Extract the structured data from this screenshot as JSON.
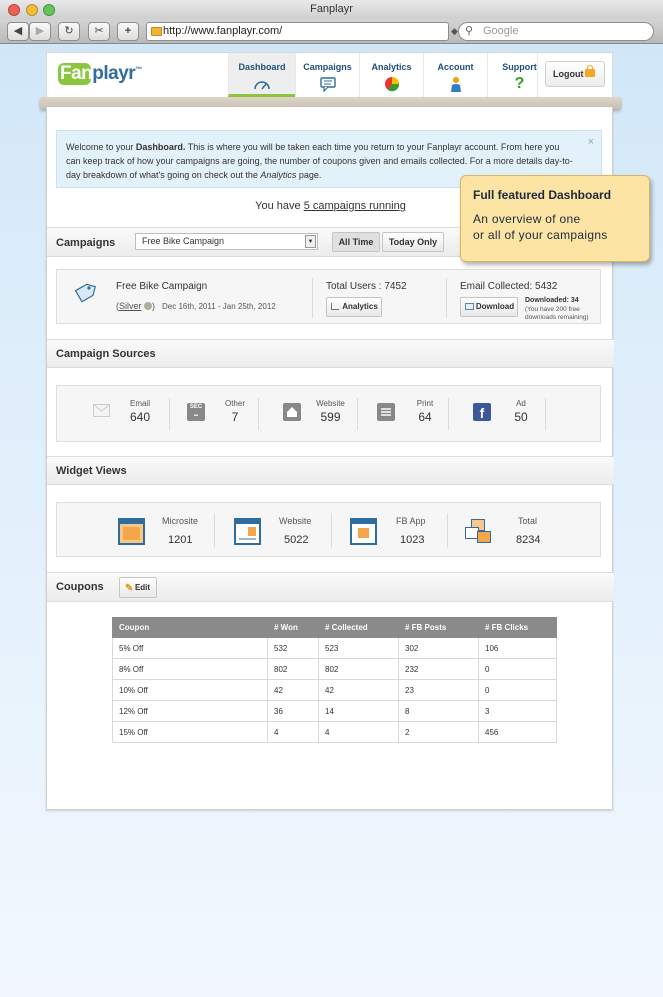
{
  "window": {
    "title": "Fanplayr"
  },
  "browser": {
    "url": "http://www.fanplayr.com/",
    "search_placeholder": "Google"
  },
  "logo": {
    "text": "Fanplayr",
    "tm": "™"
  },
  "nav": {
    "items": [
      {
        "label": "Dashboard",
        "icon": "speedometer-icon"
      },
      {
        "label": "Campaigns",
        "icon": "chat-bubble-icon"
      },
      {
        "label": "Analytics",
        "icon": "pie-chart-icon"
      },
      {
        "label": "Account",
        "icon": "user-icon"
      },
      {
        "label": "Support",
        "icon": "question-icon"
      }
    ],
    "logout_label": "Logout"
  },
  "welcome": {
    "p1": "Welcome to your ",
    "bold": "Dashboard.",
    "p2": " This is where you will be taken each time you return to your Fanplayr account. From here you can keep track of how your campaigns are going, the number of coupons given and emails collected. For a more details day-to-day breakdown of what's going on check out the ",
    "italic": "Analytics",
    "p3": " page.",
    "close": "×"
  },
  "running": {
    "prefix": "You have ",
    "link": "5 campaigns running"
  },
  "campaigns_bar": {
    "title": "Campaigns",
    "selected": "Free Bike Campaign",
    "all_time": "All Time",
    "today_only": "Today Only"
  },
  "campaign": {
    "name": "Free Bike Campaign",
    "level": "Silver",
    "dates": "Dec 16th, 2011 - Jan 25th, 2012",
    "total_users_label": "Total Users : 7452",
    "analytics_btn": "Analytics",
    "email_collected_label": "Email Collected: 5432",
    "download_btn": "Download",
    "downloaded": "Downloaded: 34",
    "remaining": "(You have 200 free downloads remaining)"
  },
  "sources": {
    "title": "Campaign Sources",
    "items": [
      {
        "label": "Email",
        "value": "640",
        "icon": "envelope-icon"
      },
      {
        "label": "Other",
        "value": "7",
        "icon": "qr-code-icon"
      },
      {
        "label": "Website",
        "value": "599",
        "icon": "home-icon"
      },
      {
        "label": "Print",
        "value": "64",
        "icon": "document-icon"
      },
      {
        "label": "Ad",
        "value": "50",
        "icon": "facebook-icon"
      }
    ]
  },
  "widgets": {
    "title": "Widget Views",
    "items": [
      {
        "label": "Microsite",
        "value": "1201",
        "icon": "microsite-icon"
      },
      {
        "label": "Website",
        "value": "5022",
        "icon": "website-icon"
      },
      {
        "label": "FB App",
        "value": "1023",
        "icon": "fb-app-icon"
      },
      {
        "label": "Total",
        "value": "8234",
        "icon": "total-windows-icon"
      }
    ]
  },
  "coupons": {
    "title": "Coupons",
    "edit_label": "Edit",
    "headers": [
      "Coupon",
      "# Won",
      "# Collected",
      "# FB Posts",
      "# FB Clicks"
    ],
    "rows": [
      [
        "5% Off",
        "532",
        "523",
        "302",
        "106"
      ],
      [
        "8% Off",
        "802",
        "802",
        "232",
        "0"
      ],
      [
        "10% Off",
        "42",
        "42",
        "23",
        "0"
      ],
      [
        "12% Off",
        "36",
        "14",
        "8",
        "3"
      ],
      [
        "15% Off",
        "4",
        "4",
        "2",
        "456"
      ]
    ]
  },
  "tooltip": {
    "title": "Full featured Dashboard",
    "line1": "An overview of one",
    "line2": "or all of your campaigns"
  },
  "colors": {
    "accent_green": "#8cc63f",
    "nav_blue": "#1f4f7a",
    "tooltip_bg": "#fbe4a4"
  }
}
